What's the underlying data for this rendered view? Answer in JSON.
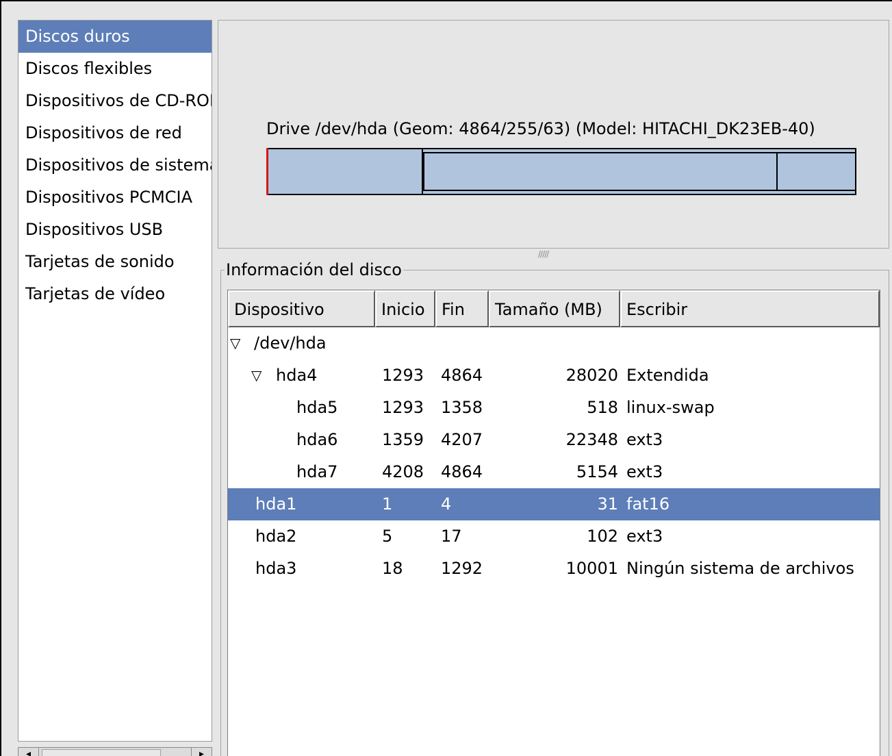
{
  "sidebar": {
    "items": [
      {
        "label": "Discos duros",
        "selected": true
      },
      {
        "label": "Discos flexibles"
      },
      {
        "label": "Dispositivos de CD-ROM"
      },
      {
        "label": "Dispositivos de red"
      },
      {
        "label": "Dispositivos de sistema"
      },
      {
        "label": "Dispositivos PCMCIA"
      },
      {
        "label": "Dispositivos USB"
      },
      {
        "label": "Tarjetas de sonido"
      },
      {
        "label": "Tarjetas de vídeo"
      }
    ]
  },
  "drive": {
    "title": "Drive /dev/hda (Geom: 4864/255/63) (Model: HITACHI_DK23EB-40)"
  },
  "disk_info": {
    "legend": "Información del disco",
    "columns": [
      "Dispositivo",
      "Inicio",
      "Fin",
      "Tamaño (MB)",
      "Escribir"
    ],
    "rows": [
      {
        "device": "/dev/hda",
        "start": "",
        "end": "",
        "size": "",
        "type": ""
      },
      {
        "device": "hda4",
        "start": "1293",
        "end": "4864",
        "size": "28020",
        "type": "Extendida"
      },
      {
        "device": "hda5",
        "start": "1293",
        "end": "1358",
        "size": "518",
        "type": "linux-swap"
      },
      {
        "device": "hda6",
        "start": "1359",
        "end": "4207",
        "size": "22348",
        "type": "ext3"
      },
      {
        "device": "hda7",
        "start": "4208",
        "end": "4864",
        "size": "5154",
        "type": "ext3"
      },
      {
        "device": "hda1",
        "start": "1",
        "end": "4",
        "size": "31",
        "type": "fat16",
        "selected": true
      },
      {
        "device": "hda2",
        "start": "5",
        "end": "17",
        "size": "102",
        "type": "ext3"
      },
      {
        "device": "hda3",
        "start": "18",
        "end": "1292",
        "size": "10001",
        "type": "Ningún sistema de archivos"
      }
    ]
  },
  "colors": {
    "selection": "#5d7eb8",
    "partition_fill": "#b0c4de",
    "selected_partition_marker": "#d01818"
  },
  "icons": {
    "expand": "triangle-down-icon",
    "scroll_left": "arrow-left-icon",
    "scroll_right": "arrow-right-icon"
  }
}
